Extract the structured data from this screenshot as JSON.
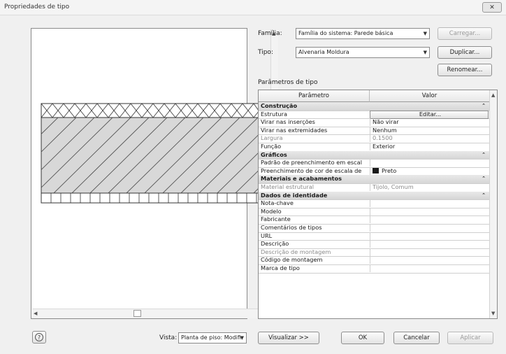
{
  "window": {
    "title": "Propriedades de tipo",
    "close_label": "✕"
  },
  "family": {
    "label": "Família:",
    "value": "Família do sistema: Parede básica"
  },
  "type": {
    "label": "Tipo:",
    "value": "Alvenaria Moldura"
  },
  "buttons": {
    "load": "Carregar...",
    "duplicate": "Duplicar...",
    "rename": "Renomear...",
    "preview": "Visualizar >>",
    "ok": "OK",
    "cancel": "Cancelar",
    "apply": "Aplicar"
  },
  "type_params_label": "Parâmetros de tipo",
  "grid": {
    "headers": [
      "Parâmetro",
      "Valor"
    ],
    "rows": [
      {
        "kind": "group",
        "name": "Construção"
      },
      {
        "kind": "param",
        "name": "Estrutura",
        "value": "Editar...",
        "button": true
      },
      {
        "kind": "param",
        "name": "Virar nas inserções",
        "value": "Não virar"
      },
      {
        "kind": "param",
        "name": "Virar nas extremidades",
        "value": "Nenhum"
      },
      {
        "kind": "param",
        "name": "Largura",
        "value": "0.1500",
        "gray": true
      },
      {
        "kind": "param",
        "name": "Função",
        "value": "Exterior"
      },
      {
        "kind": "group",
        "name": "Gráficos"
      },
      {
        "kind": "param",
        "name": "Padrão de preenchimento em escal",
        "value": ""
      },
      {
        "kind": "param",
        "name": "Preenchimento de cor de escala de",
        "value": "Preto",
        "swatch": "#1a1a1a"
      },
      {
        "kind": "group",
        "name": "Materiais e acabamentos"
      },
      {
        "kind": "param",
        "name": "Material estrutural",
        "value": "Tijolo, Comum",
        "gray": true
      },
      {
        "kind": "group",
        "name": "Dados de identidade"
      },
      {
        "kind": "param",
        "name": "Nota-chave",
        "value": ""
      },
      {
        "kind": "param",
        "name": "Modelo",
        "value": ""
      },
      {
        "kind": "param",
        "name": "Fabricante",
        "value": ""
      },
      {
        "kind": "param",
        "name": "Comentários de tipos",
        "value": ""
      },
      {
        "kind": "param",
        "name": "URL",
        "value": ""
      },
      {
        "kind": "param",
        "name": "Descrição",
        "value": ""
      },
      {
        "kind": "param",
        "name": "Descrição de montagem",
        "value": "",
        "gray": true
      },
      {
        "kind": "param",
        "name": "Código de montagem",
        "value": ""
      },
      {
        "kind": "param",
        "name": "Marca de tipo",
        "value": ""
      }
    ]
  },
  "view": {
    "label": "Vista:",
    "value": "Planta de piso: Modifi"
  },
  "icons": {
    "help": "question-icon",
    "collapse": "chevron-up-icon",
    "dropdown": "chevron-down-icon",
    "scroll_up": "arrow-up-icon",
    "scroll_down": "arrow-down-icon",
    "scroll_left": "arrow-left-icon",
    "scroll_right": "arrow-right-icon"
  },
  "colors": {
    "group_row": "#d9d9d9",
    "hatch": "#555555",
    "insulation": "#333333"
  }
}
